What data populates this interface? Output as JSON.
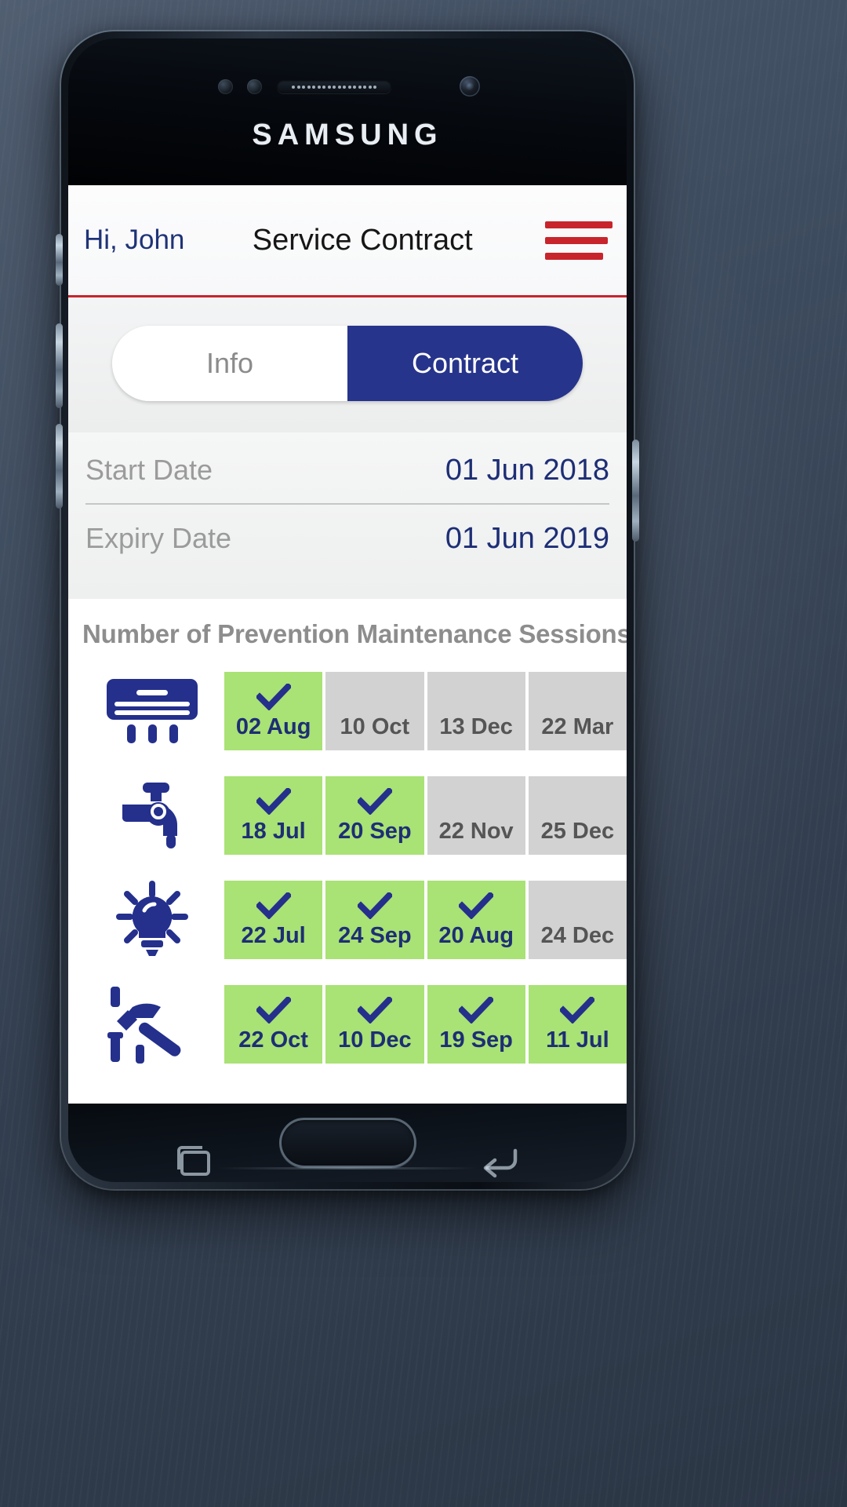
{
  "device": {
    "brand": "SAMSUNG",
    "icons": {
      "front_camera": "front-camera-icon",
      "earpiece_speaker": "speaker-icon",
      "proximity_sensor": "sensor-icon",
      "home_button": "home-button",
      "recents_key": "recents-icon",
      "back_key": "back-icon"
    }
  },
  "header": {
    "greeting": "Hi, John",
    "title": "Service Contract",
    "menu_icon": "hamburger-menu-icon",
    "accent_color": "#c8242c"
  },
  "tabs": {
    "items": [
      {
        "label": "Info",
        "active": false
      },
      {
        "label": "Contract",
        "active": true
      }
    ],
    "active_bg": "#27348b",
    "inactive_bg": "#ffffff"
  },
  "contract": {
    "rows": [
      {
        "label": "Start Date",
        "value": "01 Jun 2018"
      },
      {
        "label": "Expiry Date",
        "value": "01 Jun 2019"
      }
    ],
    "label_color": "#9b9b9b",
    "value_color": "#1d2e75"
  },
  "sessions": {
    "title": "Number of Prevention Maintenance Sessions",
    "done_color": "#a9e275",
    "pending_color": "#d2d2d2",
    "check_color": "#1d2e75",
    "rows": [
      {
        "icon": "air-conditioner-icon",
        "cells": [
          {
            "label": "02 Aug",
            "status": "done"
          },
          {
            "label": "10 Oct",
            "status": "pending"
          },
          {
            "label": "13 Dec",
            "status": "pending"
          },
          {
            "label": "22 Mar",
            "status": "pending"
          }
        ]
      },
      {
        "icon": "water-faucet-icon",
        "cells": [
          {
            "label": "18 Jul",
            "status": "done"
          },
          {
            "label": "20 Sep",
            "status": "done"
          },
          {
            "label": "22 Nov",
            "status": "pending"
          },
          {
            "label": "25 Dec",
            "status": "pending"
          }
        ]
      },
      {
        "icon": "light-bulb-icon",
        "cells": [
          {
            "label": "22 Jul",
            "status": "done"
          },
          {
            "label": "24 Sep",
            "status": "done"
          },
          {
            "label": "20 Aug",
            "status": "done"
          },
          {
            "label": "24 Dec",
            "status": "pending"
          }
        ]
      },
      {
        "icon": "hammer-screwdriver-icon",
        "cells": [
          {
            "label": "22 Oct",
            "status": "done"
          },
          {
            "label": "10 Dec",
            "status": "done"
          },
          {
            "label": "19 Sep",
            "status": "done"
          },
          {
            "label": "11 Jul",
            "status": "done"
          }
        ]
      }
    ]
  }
}
